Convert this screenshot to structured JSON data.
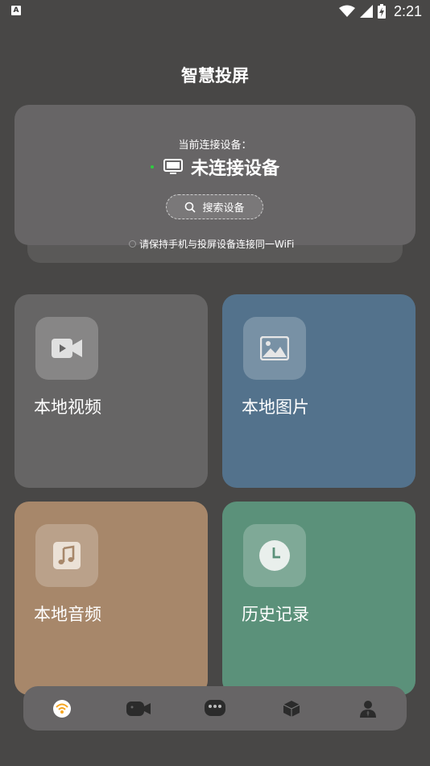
{
  "status_bar": {
    "app_icon": "A",
    "time": "2:21",
    "icons": [
      "wifi-icon",
      "signal-icon",
      "battery-charging-icon"
    ]
  },
  "page": {
    "title": "智慧投屏"
  },
  "device_card": {
    "current_label": "当前连接设备：",
    "status_dot_color": "#2ecc40",
    "device_icon": "monitor-icon",
    "device_status": "未连接设备",
    "search_button_label": "搜索设备",
    "search_icon": "search-icon",
    "hint": "请保持手机与投屏设备连接同一WiFi"
  },
  "tiles": [
    {
      "label": "本地视频",
      "icon": "video-icon",
      "color": "#666565"
    },
    {
      "label": "本地图片",
      "icon": "image-icon",
      "color": "#53728c"
    },
    {
      "label": "本地音频",
      "icon": "music-icon",
      "color": "#a7876a"
    },
    {
      "label": "历史记录",
      "icon": "clock-icon",
      "color": "#5b917a"
    }
  ],
  "bottom_nav": {
    "items": [
      {
        "icon": "cast-icon",
        "active": true
      },
      {
        "icon": "camera-icon",
        "active": false
      },
      {
        "icon": "chat-icon",
        "active": false
      },
      {
        "icon": "box-icon",
        "active": false
      },
      {
        "icon": "profile-icon",
        "active": false
      }
    ],
    "active_color": "#f5a623"
  }
}
